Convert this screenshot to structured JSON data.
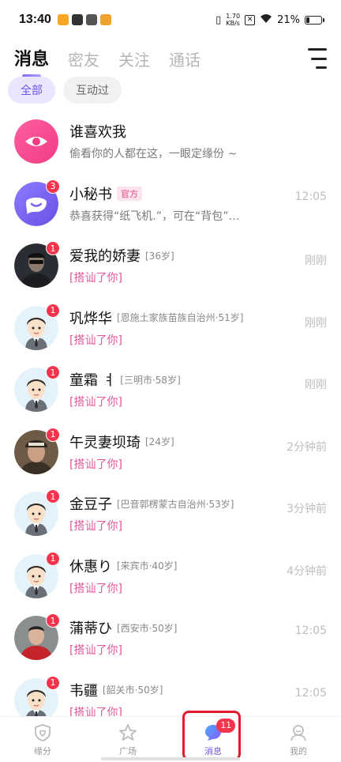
{
  "status": {
    "time": "13:40",
    "speed_value": "1.70",
    "speed_unit": "KB/s",
    "battery": "21%"
  },
  "tabs": [
    {
      "label": "消息",
      "active": true
    },
    {
      "label": "密友",
      "active": false
    },
    {
      "label": "关注",
      "active": false
    },
    {
      "label": "通话",
      "active": false
    }
  ],
  "filters": [
    {
      "label": "全部",
      "active": true
    },
    {
      "label": "互动过",
      "active": false
    }
  ],
  "messages": [
    {
      "name": "谁喜欢我",
      "meta": "",
      "tag": "",
      "preview": "偷看你的人都在这，一眼定缘份 ~",
      "time": "",
      "badge": "",
      "avatar": "eye-icon",
      "preview_color": "gray"
    },
    {
      "name": "小秘书",
      "meta": "",
      "tag": "官方",
      "preview": "恭喜获得“纸飞机.”，可在“背包”…",
      "time": "12:05",
      "badge": "3",
      "avatar": "assistant-icon",
      "preview_color": "gray"
    },
    {
      "name": "爱我的娇妻",
      "meta": "[36岁]",
      "tag": "",
      "preview": "[搭讪了你]",
      "time": "刚刚",
      "badge": "1",
      "avatar": "photo-dark",
      "preview_color": "pink"
    },
    {
      "name": "巩烨华",
      "meta": "[恩施土家族苗族自治州·51岁]",
      "tag": "",
      "preview": "[搭讪了你]",
      "time": "刚刚",
      "badge": "1",
      "avatar": "cartoon-man",
      "preview_color": "pink"
    },
    {
      "name": "童霜 ㅕ",
      "meta": "[三明市·58岁]",
      "tag": "",
      "preview": "[搭讪了你]",
      "time": "刚刚",
      "badge": "1",
      "avatar": "cartoon-man",
      "preview_color": "pink"
    },
    {
      "name": "午灵妻坝琦",
      "meta": "[24岁]",
      "tag": "",
      "preview": "[搭讪了你]",
      "time": "2分钟前",
      "badge": "1",
      "avatar": "photo-cap",
      "preview_color": "pink"
    },
    {
      "name": "金豆子",
      "meta": "[巴音郭楞蒙古自治州·53岁]",
      "tag": "",
      "preview": "[搭讪了你]",
      "time": "3分钟前",
      "badge": "1",
      "avatar": "cartoon-man",
      "preview_color": "pink"
    },
    {
      "name": "休惠り",
      "meta": "[来宾市·40岁]",
      "tag": "",
      "preview": "[搭讪了你]",
      "time": "4分钟前",
      "badge": "1",
      "avatar": "cartoon-man",
      "preview_color": "pink"
    },
    {
      "name": "蒲蒂ひ",
      "meta": "[西安市·50岁]",
      "tag": "",
      "preview": "[搭讪了你]",
      "time": "12:05",
      "badge": "1",
      "avatar": "photo-red",
      "preview_color": "pink"
    },
    {
      "name": "韦疆",
      "meta": "[韶关市·50岁]",
      "tag": "",
      "preview": "[搭讪了你]",
      "time": "12:05",
      "badge": "1",
      "avatar": "cartoon-man",
      "preview_color": "pink"
    }
  ],
  "nav": [
    {
      "label": "缘分",
      "icon": "heart-shield-icon",
      "active": false,
      "badge": ""
    },
    {
      "label": "广场",
      "icon": "star-icon",
      "active": false,
      "badge": ""
    },
    {
      "label": "消息",
      "icon": "chat-icon",
      "active": true,
      "badge": "11"
    },
    {
      "label": "我的",
      "icon": "profile-icon",
      "active": false,
      "badge": ""
    }
  ],
  "colors": {
    "accent": "#6f54e8",
    "badge": "#f4344d",
    "pink_text": "#e2569a"
  }
}
